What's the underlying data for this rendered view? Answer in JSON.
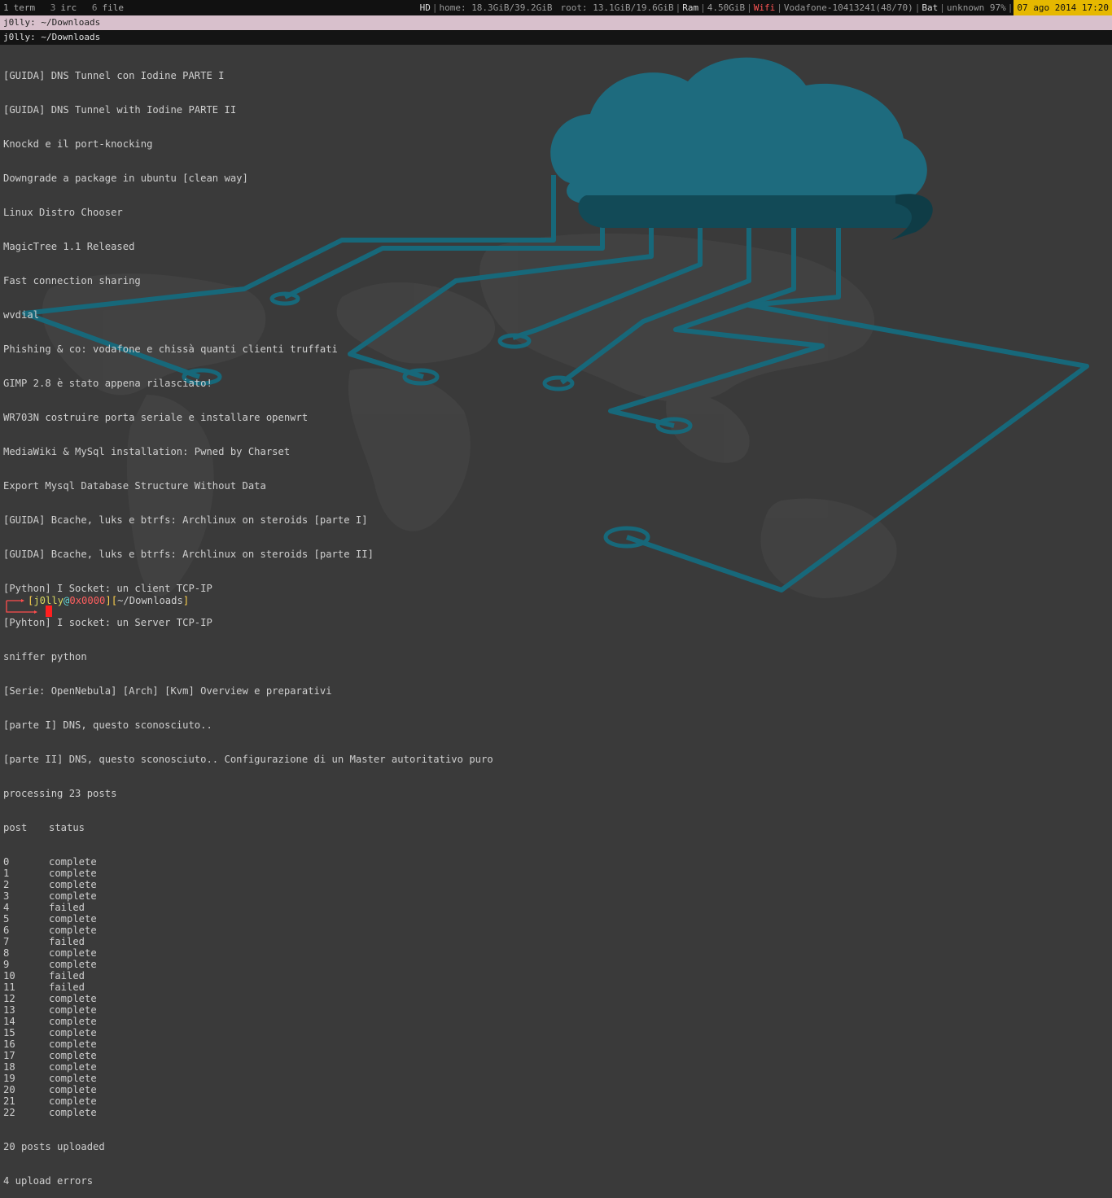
{
  "topbar": {
    "workspaces": [
      {
        "num": "1",
        "name": "term",
        "active": true
      },
      {
        "num": "3",
        "name": "irc",
        "active": false
      },
      {
        "num": "6",
        "name": "file",
        "active": false
      }
    ],
    "status": {
      "hd_label": "HD",
      "home": "home: 18.3GiB/39.2GiB",
      "root": "root: 13.1GiB/19.6GiB",
      "ram_label": "Ram",
      "ram_value": "4.50GiB",
      "wifi_label": "Wifi",
      "wifi_value": "Vodafone-10413241(48/70)",
      "bat_label": "Bat",
      "bat_value": "unknown 97%",
      "datetime": "07 ago 2014 17:20"
    }
  },
  "tabs": {
    "active_title": "j0lly: ~/Downloads",
    "current_title": "j0lly: ~/Downloads"
  },
  "terminal": {
    "titles": [
      "[GUIDA] DNS Tunnel con Iodine PARTE I",
      "[GUIDA] DNS Tunnel with Iodine PARTE II",
      "Knockd e il port-knocking",
      "Downgrade a package in ubuntu [clean way]",
      "Linux Distro Chooser",
      "MagicTree 1.1 Released",
      "Fast connection sharing",
      "wvdial",
      "Phishing & co: vodafone e chissà quanti clienti truffati",
      "GIMP 2.8 è stato appena rilasciato!",
      "WR703N costruire porta seriale e installare openwrt",
      "MediaWiki & MySql installation: Pwned by Charset",
      "Export Mysql Database Structure Without Data",
      "[GUIDA] Bcache, luks e btrfs: Archlinux on steroids [parte I]",
      "[GUIDA] Bcache, luks e btrfs: Archlinux on steroids [parte II]",
      "[Python] I Socket: un client TCP-IP",
      "[Pyhton] I socket: un Server TCP-IP",
      "sniffer python",
      "[Serie: OpenNebula] [Arch] [Kvm] Overview e preparativi",
      "[parte I] DNS, questo sconosciuto..",
      "[parte II] DNS, questo sconosciuto.. Configurazione di un Master autoritativo puro"
    ],
    "processing": "processing 23 posts",
    "headers": [
      "post",
      "status"
    ],
    "rows": [
      [
        "0",
        "complete"
      ],
      [
        "1",
        "complete"
      ],
      [
        "2",
        "complete"
      ],
      [
        "3",
        "complete"
      ],
      [
        "4",
        "failed"
      ],
      [
        "5",
        "complete"
      ],
      [
        "6",
        "complete"
      ],
      [
        "7",
        "failed"
      ],
      [
        "8",
        "complete"
      ],
      [
        "9",
        "complete"
      ],
      [
        "10",
        "failed"
      ],
      [
        "11",
        "failed"
      ],
      [
        "12",
        "complete"
      ],
      [
        "13",
        "complete"
      ],
      [
        "14",
        "complete"
      ],
      [
        "15",
        "complete"
      ],
      [
        "16",
        "complete"
      ],
      [
        "17",
        "complete"
      ],
      [
        "18",
        "complete"
      ],
      [
        "19",
        "complete"
      ],
      [
        "20",
        "complete"
      ],
      [
        "21",
        "complete"
      ],
      [
        "22",
        "complete"
      ]
    ],
    "summary": [
      "20 posts uploaded",
      "4 upload errors"
    ]
  },
  "prompt": {
    "user": "j0lly",
    "at": "@",
    "host": "0x0000",
    "path": "~/Downloads"
  },
  "colors": {
    "background": "#3a3a3a",
    "circuit": "#17687a",
    "cloud": "#1e6b7e",
    "accent_red": "#ff5555",
    "clock_bg": "#e6b800"
  }
}
